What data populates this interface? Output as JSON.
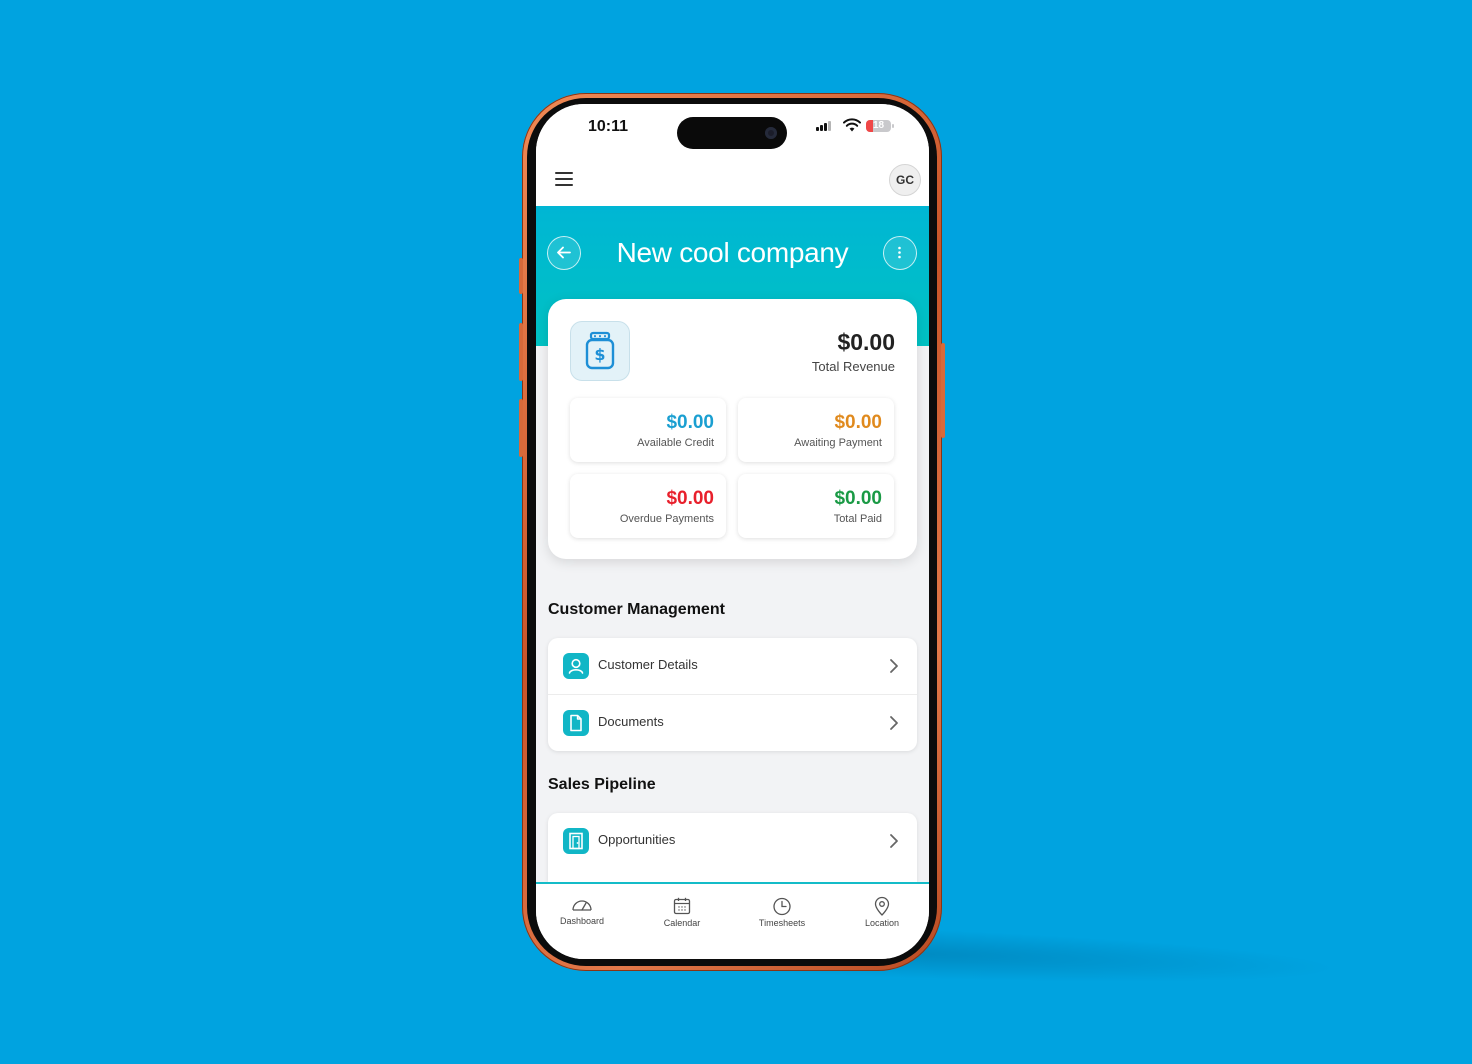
{
  "status_bar": {
    "time": "10:11",
    "battery_level": "18"
  },
  "app_bar": {
    "avatar_initials": "GC"
  },
  "header": {
    "title": "New cool company"
  },
  "summary": {
    "total_value": "$0.00",
    "total_label": "Total Revenue",
    "stats": [
      {
        "value": "$0.00",
        "label": "Available Credit",
        "color": "#1a9fd1"
      },
      {
        "value": "$0.00",
        "label": "Awaiting Payment",
        "color": "#e08a1e"
      },
      {
        "value": "$0.00",
        "label": "Overdue Payments",
        "color": "#e8202c"
      },
      {
        "value": "$0.00",
        "label": "Total Paid",
        "color": "#1a9a45"
      }
    ]
  },
  "sections": {
    "customer_management": {
      "title": "Customer Management",
      "items": [
        {
          "label": "Customer Details",
          "icon": "user-icon"
        },
        {
          "label": "Documents",
          "icon": "document-icon"
        }
      ]
    },
    "sales_pipeline": {
      "title": "Sales Pipeline",
      "items": [
        {
          "label": "Opportunities",
          "icon": "door-icon"
        }
      ]
    }
  },
  "tab_bar": {
    "tabs": [
      {
        "label": "Dashboard",
        "icon": "gauge-icon"
      },
      {
        "label": "Calendar",
        "icon": "calendar-icon"
      },
      {
        "label": "Timesheets",
        "icon": "clock-icon"
      },
      {
        "label": "Location",
        "icon": "map-pin-icon"
      }
    ]
  },
  "colors": {
    "accent": "#00b6d4",
    "background": "#00a3e0",
    "frame": "#d56a3a"
  }
}
